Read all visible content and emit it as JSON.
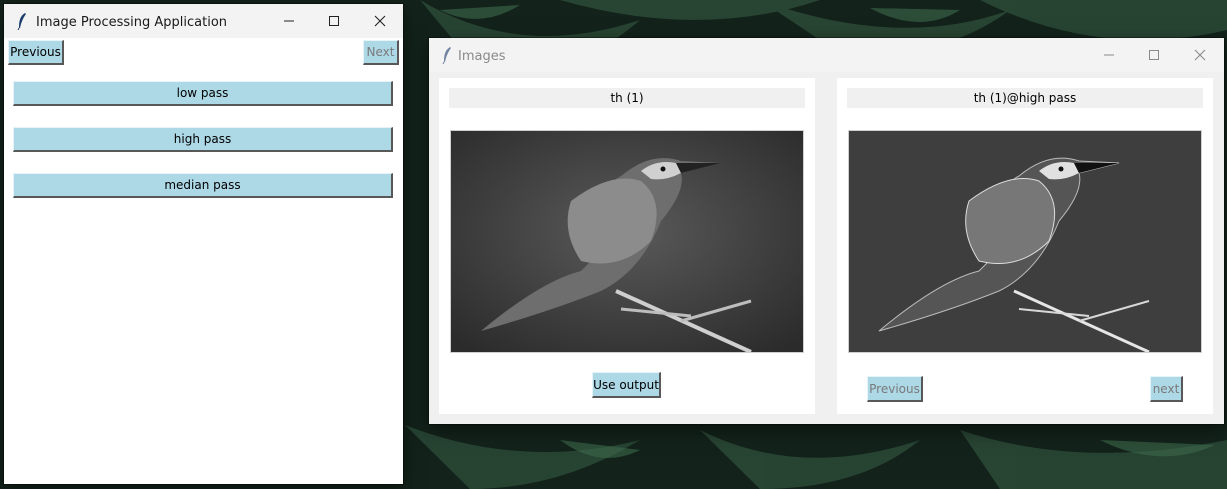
{
  "main_window": {
    "title": "Image Processing Application",
    "previous_label": "Previous",
    "next_label": "Next",
    "filters": [
      {
        "label": "low pass"
      },
      {
        "label": "high pass"
      },
      {
        "label": "median pass"
      }
    ]
  },
  "images_window": {
    "title": "Images",
    "input_panel": {
      "caption": "th (1)",
      "use_output_label": "Use output"
    },
    "output_panel": {
      "caption": "th (1)@high pass",
      "previous_label": "Previous",
      "next_label": "next"
    }
  },
  "colors": {
    "button_bg": "#add8e6",
    "titlebar_bg": "#f3f3f3",
    "caption_bg": "#f0f0f0",
    "images_bg": "#f0f0f0"
  }
}
